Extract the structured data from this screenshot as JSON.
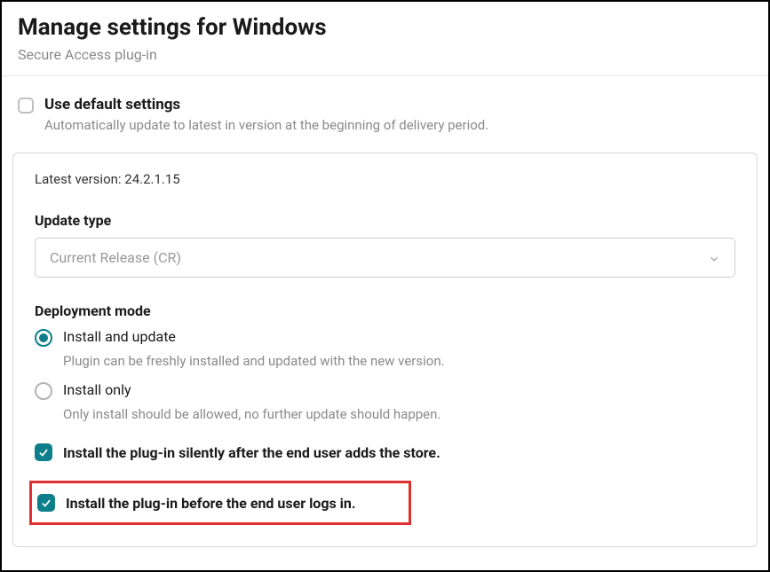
{
  "header": {
    "title": "Manage settings for Windows",
    "subtitle": "Secure Access plug-in"
  },
  "defaultSettings": {
    "title": "Use default settings",
    "description": "Automatically update to latest in version at the beginning of delivery period."
  },
  "card": {
    "latestVersion": "Latest version: 24.2.1.15",
    "updateType": {
      "label": "Update type",
      "value": "Current Release (CR)"
    },
    "deploymentMode": {
      "label": "Deployment mode",
      "options": [
        {
          "label": "Install and update",
          "description": "Plugin can be freshly installed and updated with the new version.",
          "selected": true
        },
        {
          "label": "Install only",
          "description": "Only install should be allowed, no further update should happen.",
          "selected": false
        }
      ]
    },
    "checkboxes": {
      "silentInstall": "Install the plug-in silently after the end user adds the store.",
      "installBeforeLogin": "Install the plug-in before the end user logs in."
    }
  }
}
